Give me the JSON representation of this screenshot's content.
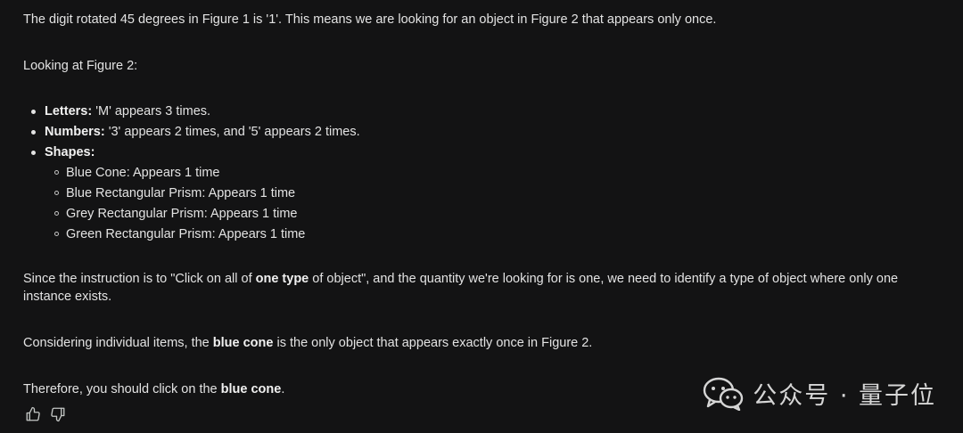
{
  "response": {
    "intro": "The digit rotated 45 degrees in Figure 1 is '1'. This means we are looking for an object in Figure 2 that appears only once.",
    "looking": "Looking at Figure 2:",
    "bullets": [
      {
        "label": "Letters:",
        "text": " 'M' appears 3 times."
      },
      {
        "label": "Numbers:",
        "text": " '3' appears 2 times, and '5' appears 2 times."
      },
      {
        "label": "Shapes:",
        "text": ""
      }
    ],
    "shapes": [
      "Blue Cone: Appears 1 time",
      "Blue Rectangular Prism: Appears 1 time",
      "Grey Rectangular Prism: Appears 1 time",
      "Green Rectangular Prism: Appears 1 time"
    ],
    "since": {
      "a": "Since the instruction is to \"Click on all of ",
      "b": "one type",
      "c": " of object\", and the quantity we're looking for is one, we need to identify a type of object where only one instance exists."
    },
    "consider": {
      "a": "Considering individual items, the ",
      "b": "blue cone",
      "c": " is the only object that appears exactly once in Figure 2."
    },
    "therefore": {
      "a": "Therefore, you should click on the ",
      "b": "blue cone",
      "c": "."
    }
  },
  "actions": {
    "thumbs_up_icon": "thumbs-up-icon",
    "thumbs_down_icon": "thumbs-down-icon"
  },
  "watermark": {
    "text": "公众号 · 量子位",
    "icon": "wechat-icon"
  },
  "colors": {
    "background": "#131314",
    "text": "#e3e3e3"
  }
}
